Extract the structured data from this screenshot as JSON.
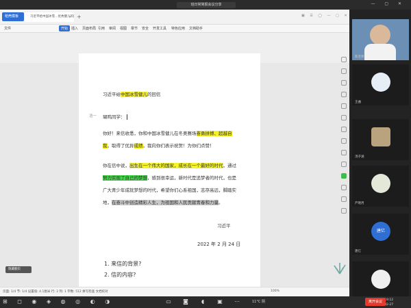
{
  "meeting": {
    "title": "班日常简报会议分享",
    "end_button": "离开会议"
  },
  "app": {
    "logo": "稻壳模板",
    "doc_tab": "习近平给中国冰雪…优秀健儿的回信",
    "menus": [
      "文件",
      "开始",
      "插入",
      "页面布局",
      "引用",
      "审阅",
      "视图",
      "章节",
      "安全",
      "开发工具",
      "特色应用",
      "文档助手"
    ]
  },
  "document": {
    "title_pre": "习近平给",
    "title_hl": "中国冰雪健儿",
    "title_post": "的回信",
    "margin_label": "浩一",
    "greeting": "瑚鸣同学：",
    "p1_a": "你好！来信收悉，你和中国冰雪健儿在冬奥赛场",
    "p1_hl1": "奋勇拼搏、超越自我",
    "p1_b": "，取得了优异",
    "p1_hl2": "成绩",
    "p1_c": "，我向你们表示祝贺！为你们点赞！",
    "p2_a": "你在信中说，",
    "p2_hl1": "出生在一个伟大的国家，成长在一个最好的时代",
    "p2_b": "，通过",
    "p2_hl2": "努力实现了自己的梦想",
    "p2_c": "，感到很幸运，新时代是追梦者的时代，也是广大青少年成就梦想的时代，希望你们心系祖国，志存高远，脚踏实地，",
    "p2_hl3": "在奋斗中创造精彩人生，为祖国和人民贡献青春和力量",
    "p2_d": "。",
    "signature": "习近平",
    "date": "2022 年 2 月 24 日",
    "q1": "1. 来信的背景?",
    "q2": "2. 信的内容?"
  },
  "statusbar": {
    "left": "页面: 1/4  节: 1/4  设置值: 4.1厘米  行: 2  列: 1  字数: 512  拼写检查  文档校对",
    "right": "100%",
    "pill": "隐藏翻页"
  },
  "taskbar": {
    "weather": "11°C 阴",
    "time": "19:12",
    "date": "2022-02-27"
  },
  "participants": [
    {
      "name": "陈老师",
      "color": "#6b8fb5"
    },
    {
      "name": "王曲",
      "color": "#e8eef5"
    },
    {
      "name": "汤子涵",
      "color": "#b9a27e"
    },
    {
      "name": "严明月",
      "color": "#e4e8d8"
    },
    {
      "name": "唐亿",
      "color": "#2f6fd4",
      "initials": "唐亿"
    },
    {
      "name": "",
      "color": "#f0f0f0"
    }
  ]
}
